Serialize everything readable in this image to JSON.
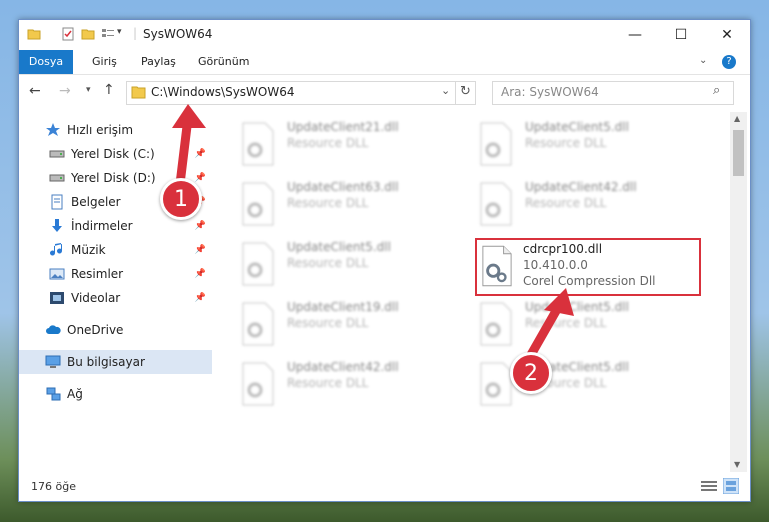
{
  "window": {
    "title": "SysWOW64"
  },
  "ribbon": {
    "tabs": [
      "Dosya",
      "Giriş",
      "Paylaş",
      "Görünüm"
    ]
  },
  "address": {
    "path": "C:\\Windows\\SysWOW64",
    "search_placeholder": "Ara: SysWOW64"
  },
  "nav": {
    "items": [
      {
        "label": "Hızlı erişim",
        "icon": "star-icon"
      },
      {
        "label": "Yerel Disk (C:)",
        "icon": "drive-icon"
      },
      {
        "label": "Yerel Disk (D:)",
        "icon": "drive-icon"
      },
      {
        "label": "Belgeler",
        "icon": "documents-icon"
      },
      {
        "label": "İndirmeler",
        "icon": "download-icon"
      },
      {
        "label": "Müzik",
        "icon": "music-icon"
      },
      {
        "label": "Resimler",
        "icon": "pictures-icon"
      },
      {
        "label": "Videolar",
        "icon": "videos-icon"
      },
      {
        "label": "OneDrive",
        "icon": "cloud-icon"
      },
      {
        "label": "Bu bilgisayar",
        "icon": "computer-icon"
      },
      {
        "label": "Ağ",
        "icon": "network-icon"
      }
    ]
  },
  "files": [
    {
      "name": "UpdateClient21.dll",
      "sub": "Resource DLL"
    },
    {
      "name": "UpdateClient5.dll",
      "sub": "Resource DLL"
    },
    {
      "name": "UpdateClient63.dll",
      "sub": "Resource DLL"
    },
    {
      "name": "UpdateClient42.dll",
      "sub": "Resource DLL"
    },
    {
      "name": "UpdateClient5.dll",
      "sub": "Resource DLL"
    },
    {
      "name": "cdrcpr100.dll",
      "sub": "10.410.0.0",
      "sub2": "Corel Compression Dll"
    },
    {
      "name": "UpdateClient19.dll",
      "sub": "Resource DLL"
    },
    {
      "name": "UpdateClient5.dll",
      "sub": "Resource DLL"
    },
    {
      "name": "UpdateClient42.dll",
      "sub": "Resource DLL"
    },
    {
      "name": "UpdateClient5.dll",
      "sub": "Resource DLL"
    }
  ],
  "status": {
    "count": "176 öğe"
  },
  "annotations": {
    "step1": "1",
    "step2": "2"
  },
  "colors": {
    "accent": "#1979ca",
    "highlight": "#d9313c"
  }
}
